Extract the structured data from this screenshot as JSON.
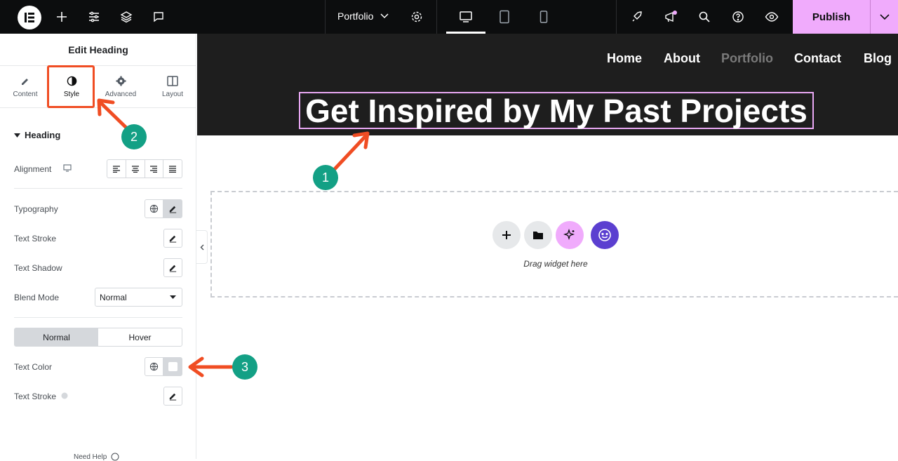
{
  "topbar": {
    "page_name": "Portfolio",
    "publish_label": "Publish"
  },
  "panel": {
    "title": "Edit Heading",
    "tabs": [
      {
        "label": "Content"
      },
      {
        "label": "Style"
      },
      {
        "label": "Advanced"
      },
      {
        "label": "Layout"
      }
    ],
    "section_title": "Heading",
    "rows": {
      "alignment": "Alignment",
      "typography": "Typography",
      "text_stroke": "Text Stroke",
      "text_shadow": "Text Shadow",
      "blend_mode": "Blend Mode",
      "blend_mode_value": "Normal",
      "state_normal": "Normal",
      "state_hover": "Hover",
      "text_color": "Text Color",
      "text_stroke_2": "Text Stroke"
    },
    "need_help": "Need Help"
  },
  "canvas": {
    "nav": [
      "Home",
      "About",
      "Portfolio",
      "Contact",
      "Blog"
    ],
    "heading": "Get Inspired by My Past Projects",
    "drop_text": "Drag widget here"
  },
  "annotations": [
    "1",
    "2",
    "3"
  ],
  "colors": {
    "accent_pink": "#f0abfc",
    "annotation_red": "#f04d23",
    "annotation_teal": "#13a085",
    "header_bg": "#1e1e1e"
  }
}
